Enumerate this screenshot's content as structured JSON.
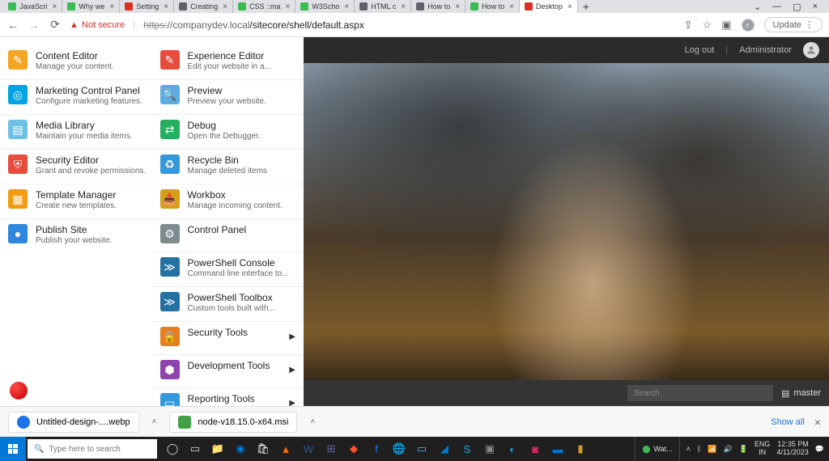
{
  "browser": {
    "tabs": [
      {
        "label": "JavaScri",
        "fav": "#3cba54"
      },
      {
        "label": "Why we",
        "fav": "#3cba54"
      },
      {
        "label": "Setting",
        "fav": "#d93025"
      },
      {
        "label": "Creating",
        "fav": "#5f6368"
      },
      {
        "label": "CSS ::ma",
        "fav": "#3cba54"
      },
      {
        "label": "W3Scho",
        "fav": "#3cba54"
      },
      {
        "label": "HTML c",
        "fav": "#5f6368"
      },
      {
        "label": "How to",
        "fav": "#5f6368"
      },
      {
        "label": "How to",
        "fav": "#3cba54"
      },
      {
        "label": "Desktop",
        "fav": "#d93025",
        "active": true
      }
    ],
    "not_secure": "Not secure",
    "url_https": "https:",
    "url_host": "//companydev.local",
    "url_path": "/sitecore/shell/default.aspx",
    "update": "Update"
  },
  "left_col": [
    {
      "title": "Content Editor",
      "desc": "Manage your content.",
      "icon_bg": "#f5a623",
      "glyph": "✎"
    },
    {
      "title": "Marketing Control Panel",
      "desc": "Configure marketing features.",
      "icon_bg": "#00a4e4",
      "glyph": "◎"
    },
    {
      "title": "Media Library",
      "desc": "Maintain your media items.",
      "icon_bg": "#6ec1e4",
      "glyph": "▤"
    },
    {
      "title": "Security Editor",
      "desc": "Grant and revoke permissions.",
      "icon_bg": "#e74c3c",
      "glyph": "⛨"
    },
    {
      "title": "Template Manager",
      "desc": "Create new templates.",
      "icon_bg": "#f39c12",
      "glyph": "▦"
    },
    {
      "title": "Publish Site",
      "desc": "Publish your website.",
      "icon_bg": "#2e86de",
      "glyph": "●"
    }
  ],
  "right_col": [
    {
      "title": "Experience Editor",
      "desc": "Edit your website in a...",
      "icon_bg": "#e74c3c",
      "glyph": "✎"
    },
    {
      "title": "Preview",
      "desc": "Preview your website.",
      "icon_bg": "#5dade2",
      "glyph": "🔍"
    },
    {
      "title": "Debug",
      "desc": "Open the Debugger.",
      "icon_bg": "#27ae60",
      "glyph": "⇄"
    },
    {
      "title": "Recycle Bin",
      "desc": "Manage deleted items",
      "icon_bg": "#3498db",
      "glyph": "♻"
    },
    {
      "title": "Workbox",
      "desc": "Manage incoming content.",
      "icon_bg": "#d4a017",
      "glyph": "📥"
    },
    {
      "title": "Control Panel",
      "desc": "",
      "icon_bg": "#7f8c8d",
      "glyph": "⚙"
    },
    {
      "title": "PowerShell Console",
      "desc": "Command line interface to...",
      "icon_bg": "#2471a3",
      "glyph": "≫"
    },
    {
      "title": "PowerShell Toolbox",
      "desc": "Custom tools built with...",
      "icon_bg": "#2471a3",
      "glyph": "≫"
    },
    {
      "title": "Security Tools",
      "desc": "",
      "icon_bg": "#e67e22",
      "glyph": "🔒",
      "arrow": true
    },
    {
      "title": "Development Tools",
      "desc": "",
      "icon_bg": "#8e44ad",
      "glyph": "⬢",
      "arrow": true
    },
    {
      "title": "Reporting Tools",
      "desc": "",
      "icon_bg": "#3498db",
      "glyph": "▭",
      "arrow": true
    }
  ],
  "desktop": {
    "logout": "Log out",
    "user": "Administrator",
    "search_placeholder": "Search",
    "database": "master"
  },
  "downloads": {
    "items": [
      {
        "name": "Untitled-design-....webp",
        "color": "#1a73e8"
      },
      {
        "name": "node-v18.15.0-x64.msi",
        "color": "#43a047"
      }
    ],
    "show_all": "Show all"
  },
  "taskbar": {
    "search_placeholder": "Type here to search",
    "weather": "Wat...",
    "lang1": "ENG",
    "lang2": "IN",
    "time": "12:35 PM",
    "date": "4/11/2023"
  }
}
